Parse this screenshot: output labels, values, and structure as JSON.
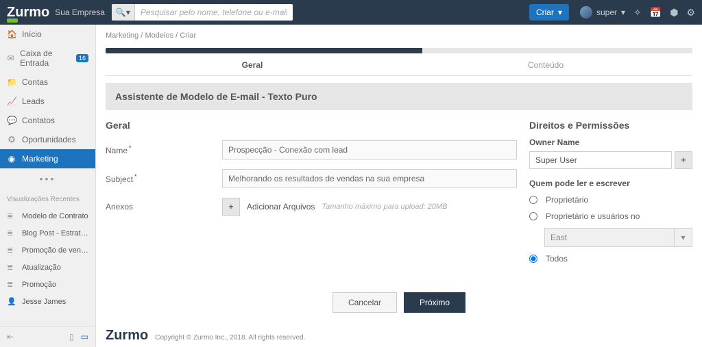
{
  "topbar": {
    "logo": "Zurmo",
    "company": "Sua Empresa",
    "search_scope_icon": "🔍",
    "search_placeholder": "Pesquisar pelo nome, telefone ou e-mail",
    "criar_label": "Criar",
    "user_name": "super"
  },
  "sidebar": {
    "items": [
      {
        "icon": "🏠",
        "label": "Início"
      },
      {
        "icon": "✉",
        "label": "Caixa de Entrada",
        "badge": "16"
      },
      {
        "icon": "📁",
        "label": "Contas"
      },
      {
        "icon": "📈",
        "label": "Leads"
      },
      {
        "icon": "💬",
        "label": "Contatos"
      },
      {
        "icon": "✪",
        "label": "Oportunidades"
      },
      {
        "icon": "◉",
        "label": "Marketing"
      }
    ],
    "recent_title": "Visualizações Recentes",
    "recent": [
      "Modelo de Contrato",
      "Blog Post - Estrat…",
      "Promoção de ven…",
      "Atualização",
      "Promoção",
      "Jesse James"
    ]
  },
  "breadcrumb": {
    "a": "Marketing",
    "b": "Modelos",
    "c": "Criar"
  },
  "tabs": {
    "geral": "Geral",
    "conteudo": "Conteúdo"
  },
  "panel_title": "Assistente de Modelo de E-mail - Texto Puro",
  "form": {
    "section_title": "Geral",
    "name_label": "Name",
    "name_value": "Prospecção - Conexão com lead",
    "subject_label": "Subject",
    "subject_value": "Melhorando os resultados de vendas na sua empresa",
    "attach_label": "Anexos",
    "attach_add": "Adicionar Arquivos",
    "attach_hint": "Tamanho máximo para upload: 20MB"
  },
  "rights": {
    "title": "Direitos e Permissões",
    "owner_label": "Owner Name",
    "owner_value": "Super User",
    "who_label": "Quem pode ler e escrever",
    "opt1": "Proprietário",
    "opt2": "Proprietário e usuários no",
    "group_value": "East",
    "opt3": "Todos"
  },
  "buttons": {
    "cancel": "Cancelar",
    "next": "Próximo"
  },
  "footer": {
    "logo": "Zurmo",
    "copy": "Copyright © Zurmo Inc., 2018. All rights reserved."
  }
}
